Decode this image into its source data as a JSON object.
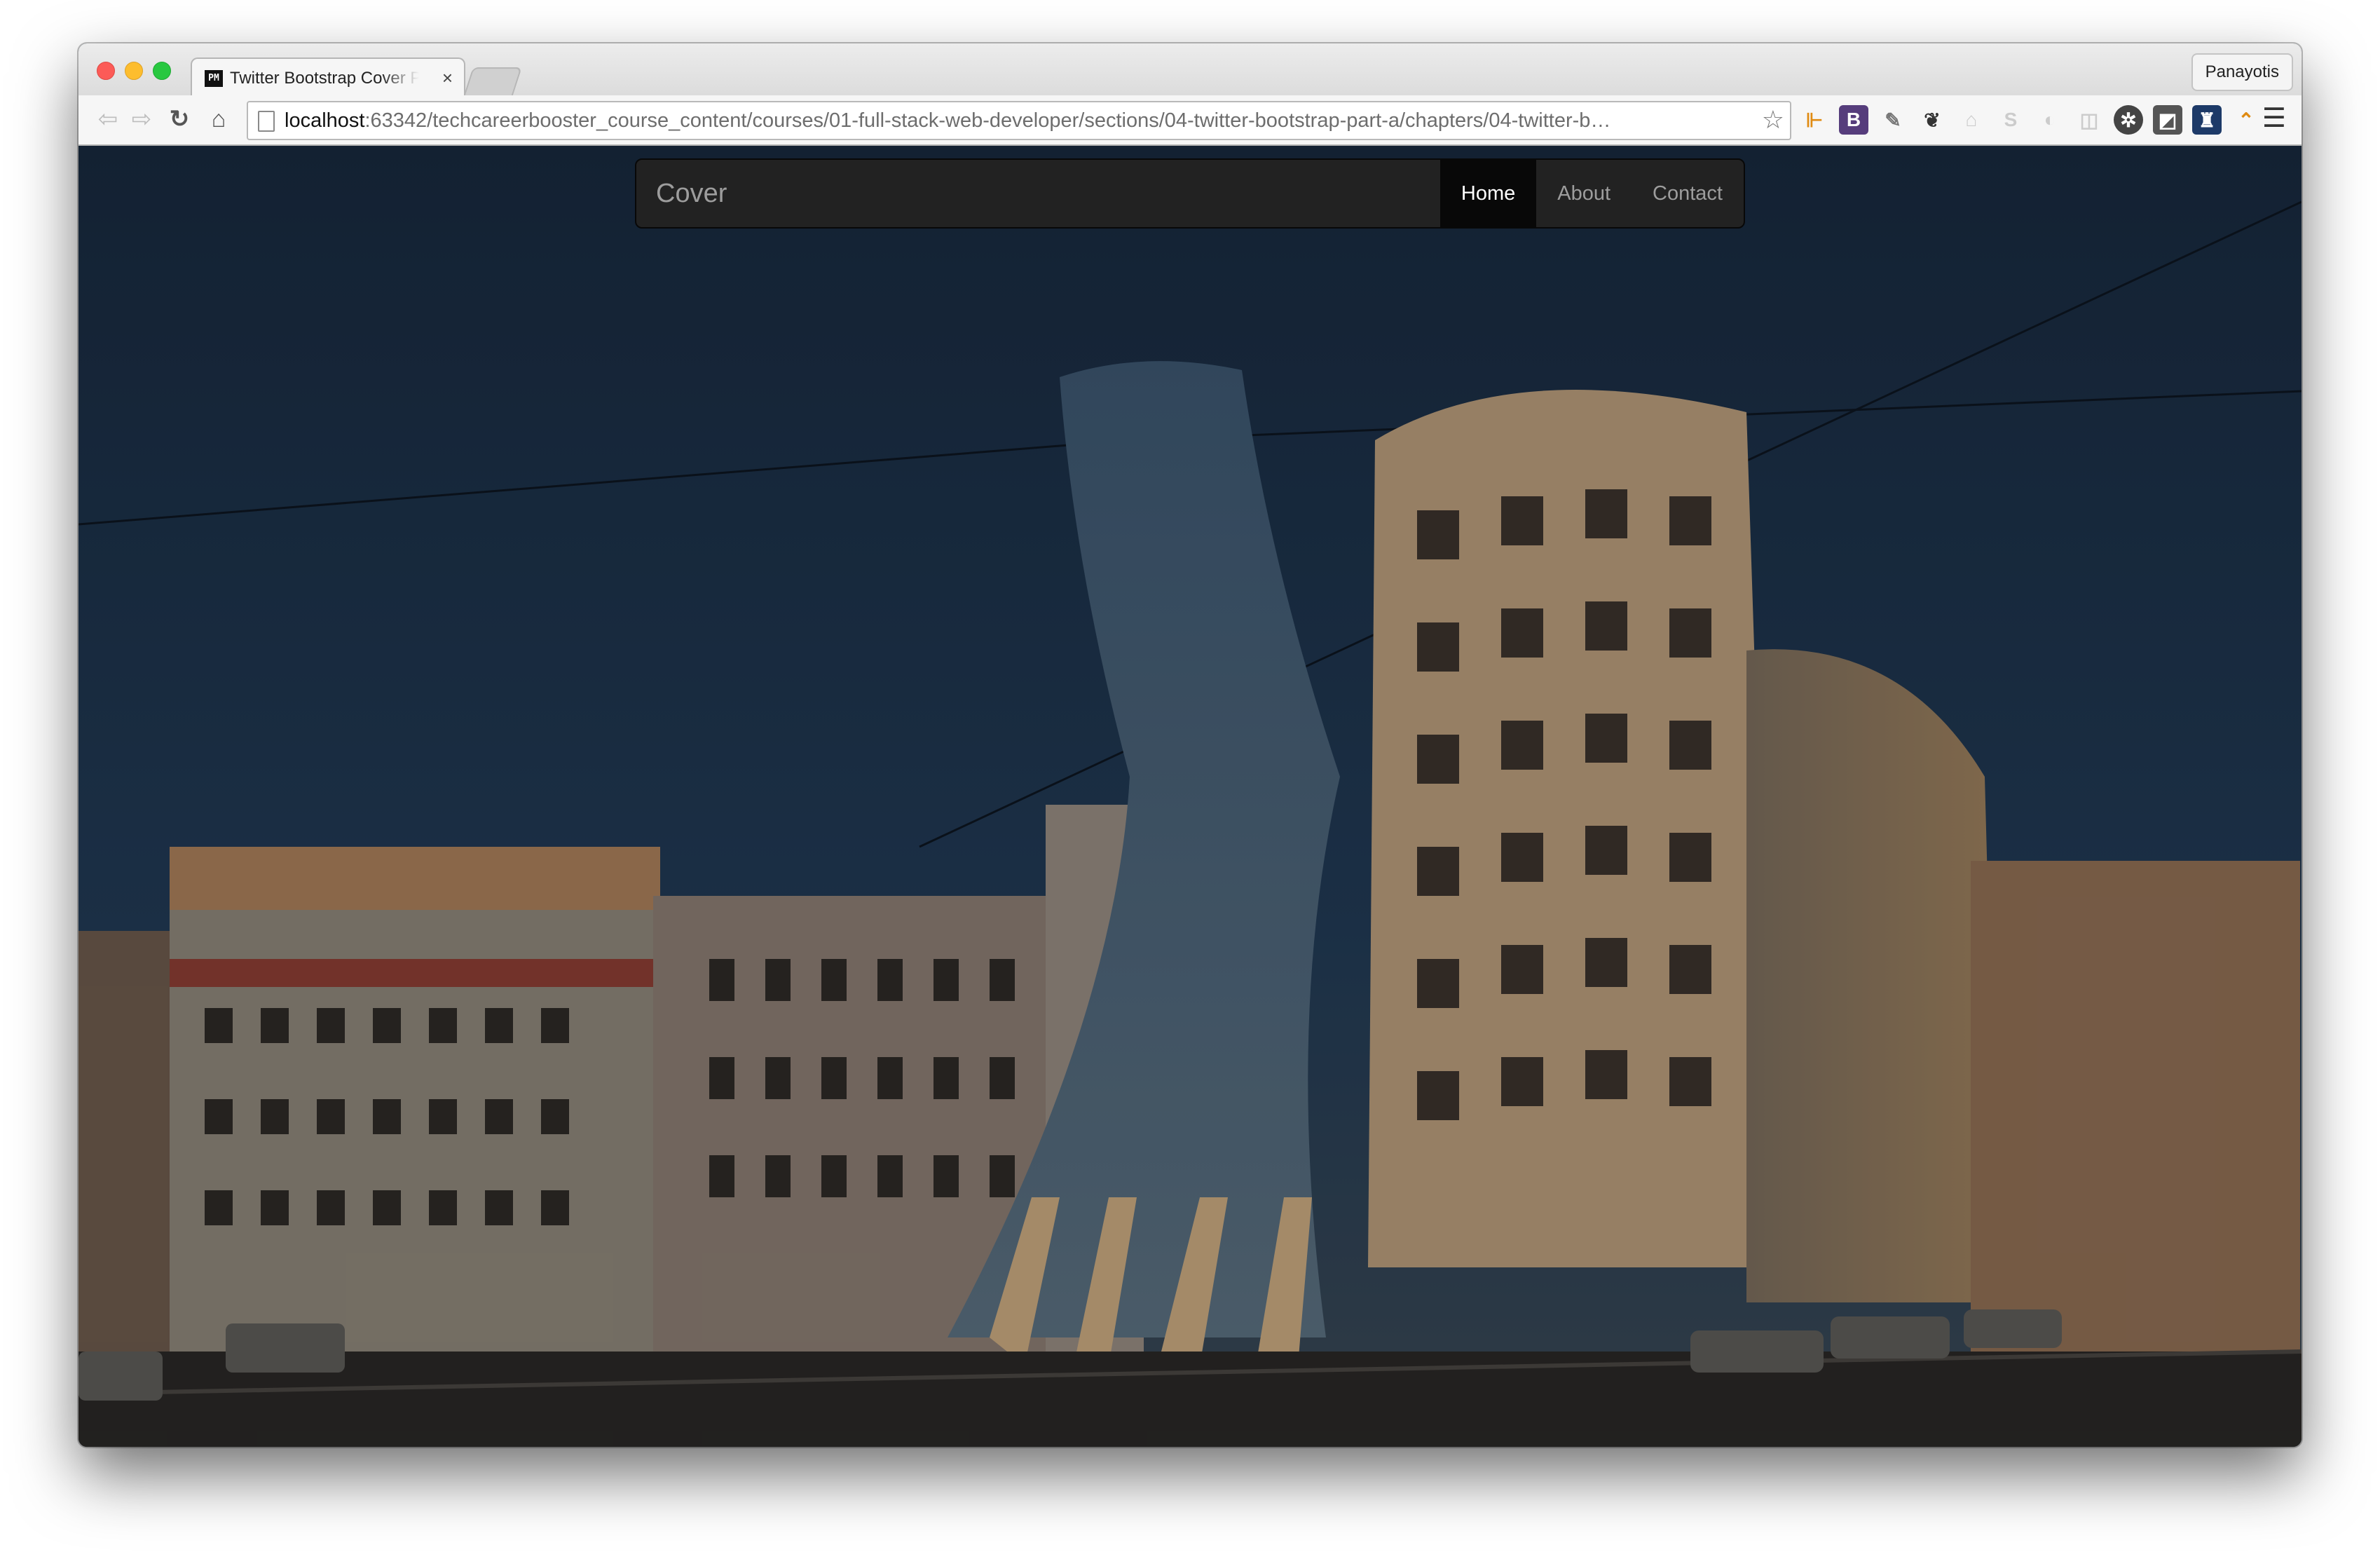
{
  "browser": {
    "tab_title": "Twitter Bootstrap Cover Page",
    "tab_favicon": "PM",
    "profile_name": "Panayotis",
    "url_host": "localhost",
    "url_rest": ":63342/techcareerbooster_course_content/courses/01-full-stack-web-developer/sections/04-twitter-bootstrap-part-a/chapters/04-twitter-b…"
  },
  "extensions": [
    {
      "name": "ruler-extension-icon",
      "glyph": "⊩",
      "style": "o"
    },
    {
      "name": "bootstrap-extension-icon",
      "glyph": "B",
      "style": "b"
    },
    {
      "name": "eyedropper-extension-icon",
      "glyph": "✎",
      "style": "g"
    },
    {
      "name": "evernote-extension-icon",
      "glyph": "❦",
      "style": "d"
    },
    {
      "name": "sitemap-extension-icon",
      "glyph": "⌂",
      "style": "l"
    },
    {
      "name": "skype-extension-icon",
      "glyph": "S",
      "style": "l"
    },
    {
      "name": "pocket-extension-icon",
      "glyph": "◐",
      "style": "l"
    },
    {
      "name": "wappalyzer-extension-icon",
      "glyph": "◫",
      "style": "l"
    },
    {
      "name": "aperture-extension-icon",
      "glyph": "✲",
      "style": "blk"
    },
    {
      "name": "screenshot-extension-icon",
      "glyph": "◩",
      "style": "sq"
    },
    {
      "name": "ghostery-extension-icon",
      "glyph": "♜",
      "style": "nv"
    },
    {
      "name": "colorzilla-extension-icon",
      "glyph": "⌃",
      "style": "o"
    }
  ],
  "page": {
    "brand": "Cover",
    "nav": [
      {
        "label": "Home",
        "active": true
      },
      {
        "label": "About",
        "active": false
      },
      {
        "label": "Contact",
        "active": false
      }
    ]
  },
  "colors": {
    "navbar_bg": "#222222",
    "nav_active_bg": "#080808",
    "nav_text": "#9d9d9d"
  }
}
